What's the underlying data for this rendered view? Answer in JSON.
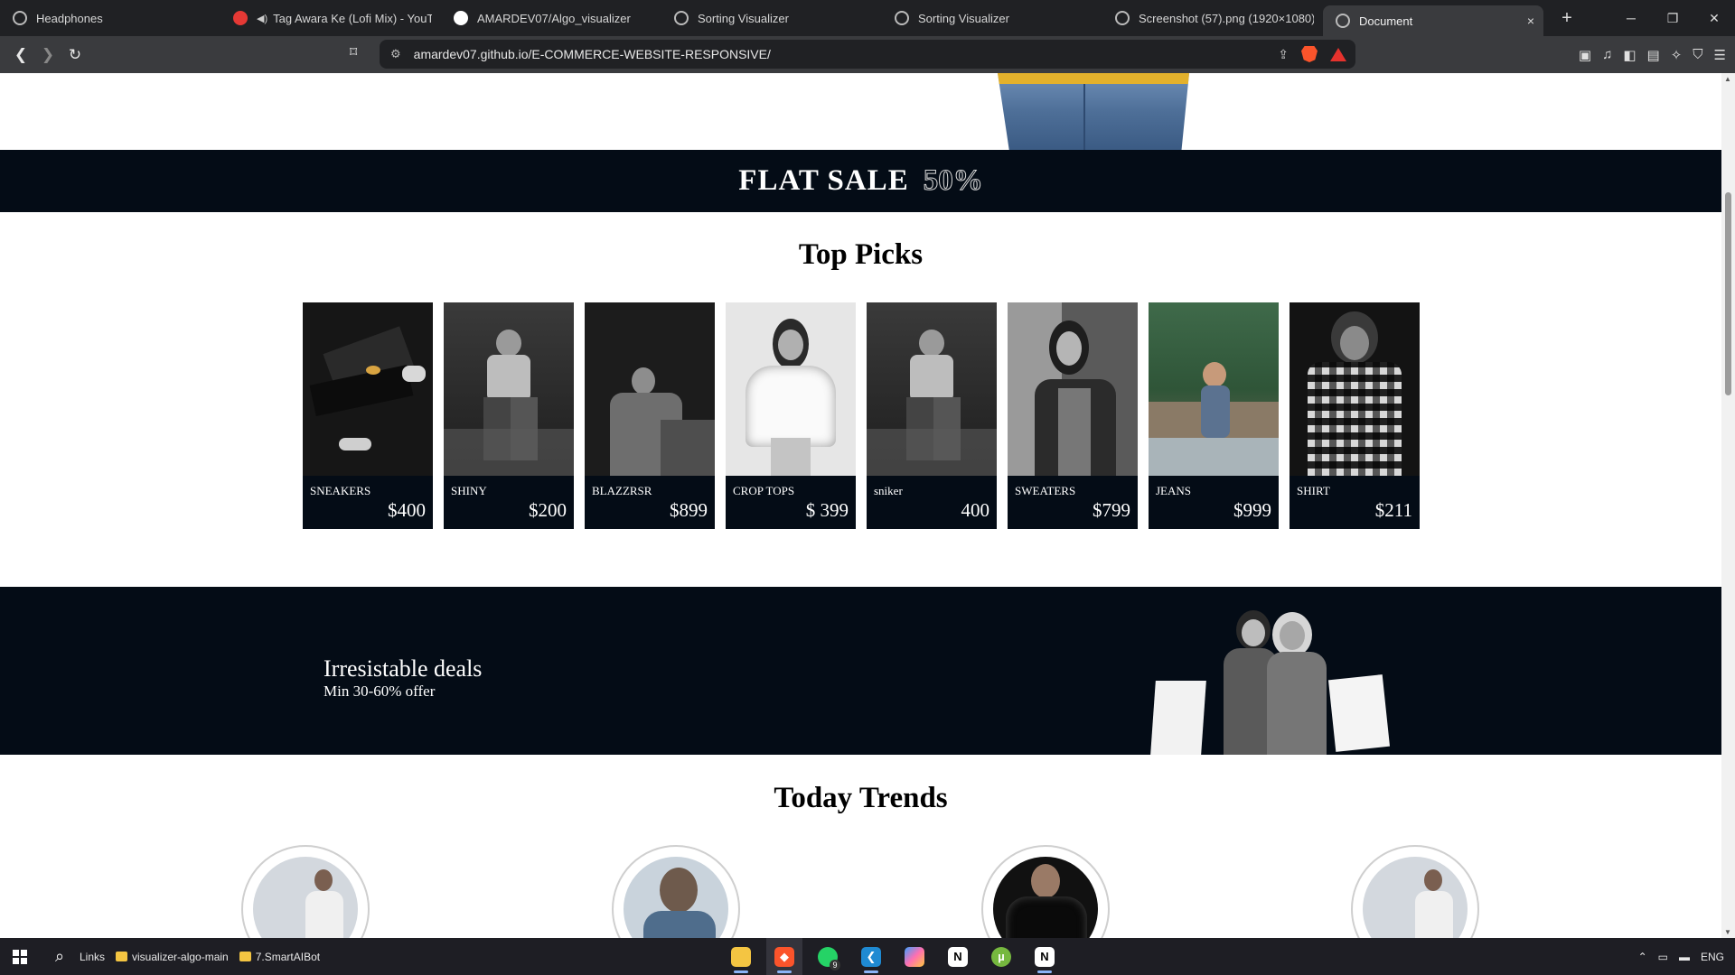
{
  "browser": {
    "tabs": [
      {
        "title": "Headphones",
        "icon": "brave-icon",
        "audio": false
      },
      {
        "title": "Tag Awara Ke (Lofi Mix) - YouTube",
        "icon": "youtube-icon",
        "audio": true
      },
      {
        "title": "AMARDEV07/Algo_visualizer",
        "icon": "github-icon",
        "audio": false
      },
      {
        "title": "Sorting Visualizer",
        "icon": "globe-icon",
        "audio": false
      },
      {
        "title": "Sorting Visualizer",
        "icon": "globe-icon",
        "audio": false
      },
      {
        "title": "Screenshot (57).png (1920×1080)",
        "icon": "globe-icon",
        "audio": false
      },
      {
        "title": "Document",
        "icon": "globe-icon",
        "audio": false,
        "active": true
      }
    ],
    "new_tab": "+",
    "close_tab": "×",
    "url": "amardev07.github.io/E-COMMERCE-WEBSITE-RESPONSIVE/"
  },
  "page": {
    "banner": {
      "text": "FLAT SALE",
      "highlight": "50%"
    },
    "top_picks": {
      "title": "Top Picks",
      "items": [
        {
          "name": "SNEAKERS",
          "price": "$400"
        },
        {
          "name": "SHINY",
          "price": "$200"
        },
        {
          "name": "BLAZZRSR",
          "price": "$899"
        },
        {
          "name": "CROP  TOPS",
          "price": "$ 399"
        },
        {
          "name": "sniker",
          "price": "400"
        },
        {
          "name": "SWEATERS",
          "price": "$799"
        },
        {
          "name": "JEANS",
          "price": "$999"
        },
        {
          "name": "SHIRT",
          "price": "$211"
        }
      ]
    },
    "deals": {
      "heading": "Irresistable deals",
      "sub": "Min 30-60% offer"
    },
    "today_trends": {
      "title": "Today Trends"
    }
  },
  "taskbar": {
    "links_label": "Links",
    "folders": [
      "visualizer-algo-main",
      "7.SmartAIBot"
    ],
    "whatsapp_badge": "9",
    "lang": "ENG"
  },
  "colors": {
    "dark": "#040c16",
    "chrome": "#3a3b3e",
    "tabbar": "#202124"
  }
}
